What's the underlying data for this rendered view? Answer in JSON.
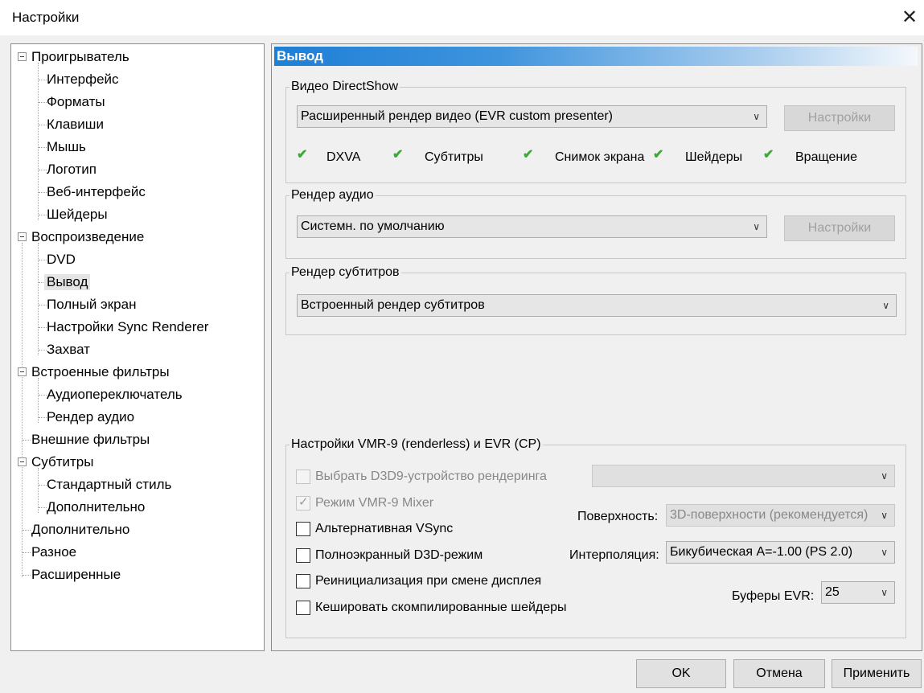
{
  "window": {
    "title": "Настройки",
    "close_glyph": "✕"
  },
  "tree": {
    "items": [
      "Проигрыватель",
      "Интерфейс",
      "Форматы",
      "Клавиши",
      "Мышь",
      "Логотип",
      "Веб-интерфейс",
      "Шейдеры",
      "Воспроизведение",
      "DVD",
      "Вывод",
      "Полный экран",
      "Настройки Sync Renderer",
      "Захват",
      "Встроенные фильтры",
      "Аудиопереключатель",
      "Рендер аудио",
      "Внешние фильтры",
      "Субтитры",
      "Стандартный стиль",
      "Дополнительно",
      "Дополнительно",
      "Разное",
      "Расширенные"
    ],
    "selected": "Вывод"
  },
  "panel": {
    "header": "Вывод",
    "video": {
      "legend": "Видео DirectShow",
      "renderer": "Расширенный рендер видео (EVR custom presenter)",
      "settings_button": "Настройки",
      "features": [
        "DXVA",
        "Субтитры",
        "Снимок экрана",
        "Шейдеры",
        "Вращение"
      ]
    },
    "audio": {
      "legend": "Рендер аудио",
      "renderer": "Системн. по умолчанию",
      "settings_button": "Настройки"
    },
    "subtitles": {
      "legend": "Рендер субтитров",
      "renderer": "Встроенный рендер субтитров"
    },
    "vmr": {
      "legend": "Настройки VMR-9 (renderless) и EVR (CP)",
      "select_device_label": "Выбрать D3D9-устройство рендеринга",
      "select_device_value": "",
      "mixer_label": "Режим VMR-9 Mixer",
      "alt_vsync_label": "Альтернативная VSync",
      "fullscreen_label": "Полноэкранный D3D-режим",
      "reinit_label": "Реинициализация при смене дисплея",
      "cache_label": "Кешировать скомпилированные шейдеры",
      "surface_label": "Поверхность:",
      "surface_value": "3D-поверхности (рекомендуется)",
      "interp_label": "Интерполяция:",
      "interp_value": "Бикубическая A=-1.00 (PS 2.0)",
      "buffers_label": "Буферы EVR:",
      "buffers_value": "25"
    }
  },
  "footer": {
    "ok": "OK",
    "cancel": "Отмена",
    "apply": "Применить"
  },
  "colors": {
    "header_blue": "#1e7fd6",
    "check_green": "#3aaa35"
  }
}
